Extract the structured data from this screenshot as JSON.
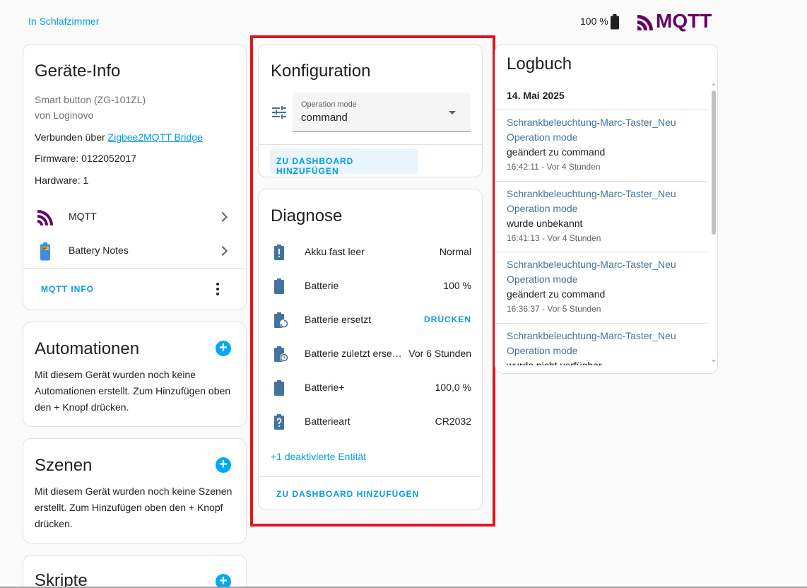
{
  "header": {
    "area_link": "In Schlafzimmer",
    "battery_level": "100 %",
    "brand_logo_text": "MQTT"
  },
  "device_info": {
    "title": "Geräte-Info",
    "model": "Smart button (ZG-101ZL)",
    "manufacturer": "von Loginovo",
    "connected_via_prefix": "Verbunden über ",
    "connected_via_link": "Zigbee2MQTT Bridge",
    "firmware": "Firmware: 0122052017",
    "hardware": "Hardware: 1",
    "integrations": [
      {
        "label": "MQTT"
      },
      {
        "label": "Battery Notes"
      }
    ],
    "action_label": "MQTT INFO"
  },
  "automations": {
    "title": "Automationen",
    "text": "Mit diesem Gerät wurden noch keine Automationen erstellt. Zum Hinzufügen oben den + Knopf drücken."
  },
  "scenes": {
    "title": "Szenen",
    "text": "Mit diesem Gerät wurden noch keine Szenen erstellt. Zum Hinzufügen oben den + Knopf drücken."
  },
  "scripts": {
    "title": "Skripte"
  },
  "config": {
    "title": "Konfiguration",
    "select_label": "Operation mode",
    "select_value": "command",
    "add_dashboard": "ZU DASHBOARD HINZUFÜGEN"
  },
  "diagnose": {
    "title": "Diagnose",
    "rows": [
      {
        "label": "Akku fast leer",
        "value": "Normal",
        "icon": "battery-alert-icon"
      },
      {
        "label": "Batterie",
        "value": "100 %",
        "icon": "battery-icon"
      },
      {
        "label": "Batterie ersetzt",
        "value": "DRÜCKEN",
        "icon": "battery-sync-icon"
      },
      {
        "label": "Batterie zuletzt erse…",
        "value": "Vor 6 Stunden",
        "icon": "battery-clock-icon"
      },
      {
        "label": "Batterie+",
        "value": "100,0 %",
        "icon": "battery-icon"
      },
      {
        "label": "Batterieart",
        "value": "CR2032",
        "icon": "battery-unknown-icon"
      }
    ],
    "disabled_entities": "+1 deaktivierte Entität",
    "add_dashboard": "ZU DASHBOARD HINZUFÜGEN"
  },
  "logbook": {
    "title": "Logbuch",
    "date": "14. Mai 2025",
    "entries": [
      {
        "name": "Schrankbeleuchtung-Marc-Taster_Neu",
        "entity": "Operation mode",
        "message": "geändert zu command",
        "time": "16:42:11 - Vor 4 Stunden"
      },
      {
        "name": "Schrankbeleuchtung-Marc-Taster_Neu",
        "entity": "Operation mode",
        "message": "wurde unbekannt",
        "time": "16:41:13 - Vor 4 Stunden"
      },
      {
        "name": "Schrankbeleuchtung-Marc-Taster_Neu",
        "entity": "Operation mode",
        "message": "geändert zu command",
        "time": "16:36:37 - Vor 5 Stunden"
      },
      {
        "name": "Schrankbeleuchtung-Marc-Taster_Neu",
        "entity": "Operation mode",
        "message": "wurde nicht verfügbar",
        "time": ""
      }
    ]
  },
  "colors": {
    "accent": "#03a9f4",
    "link": "#039be5",
    "highlight_border": "#e0161e",
    "mqtt_brand": "#660066",
    "icon": "#44739e"
  }
}
